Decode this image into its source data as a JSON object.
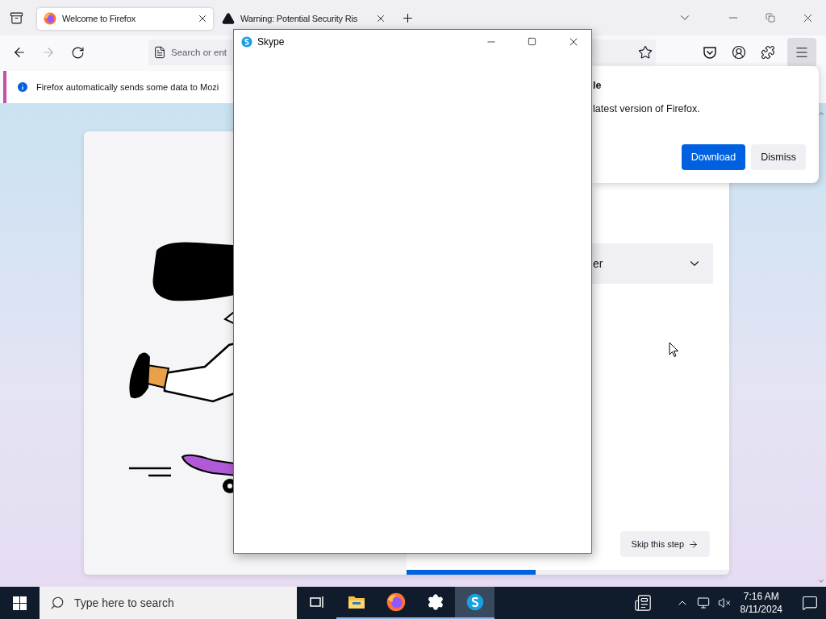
{
  "browser": {
    "tabs": [
      {
        "title": "Welcome to Firefox",
        "kind": "browser",
        "selected": true
      },
      {
        "title": "Warning: Potential Security Ris",
        "kind": "warning",
        "selected": false
      }
    ],
    "address_bar": {
      "placeholder": "Search or ent"
    },
    "notification": {
      "text": "Firefox automatically sends some data to Mozi"
    },
    "update_popup": {
      "title": "le",
      "message": "latest version of Firefox.",
      "buttons": [
        {
          "label": "Download",
          "kind": "primary"
        },
        {
          "label": "Dismiss",
          "kind": "secondary"
        }
      ]
    },
    "page": {
      "dropdown": {
        "value": "er"
      },
      "skip_button": "Skip this step",
      "progress": {
        "level": 0.4
      }
    }
  },
  "skype_window": {
    "title": "Skype"
  },
  "taskbar": {
    "search": {
      "placeholder": "Type here to search"
    },
    "apps": [
      {
        "kind": "task-view",
        "running": false,
        "selected": false
      },
      {
        "kind": "folder",
        "running": true,
        "selected": false
      },
      {
        "kind": "browser",
        "running": true,
        "selected": false
      },
      {
        "kind": "settings",
        "running": true,
        "selected": false
      },
      {
        "kind": "chat",
        "running": true,
        "selected": true
      }
    ],
    "time": "7:16 AM",
    "date": "8/11/2024"
  }
}
